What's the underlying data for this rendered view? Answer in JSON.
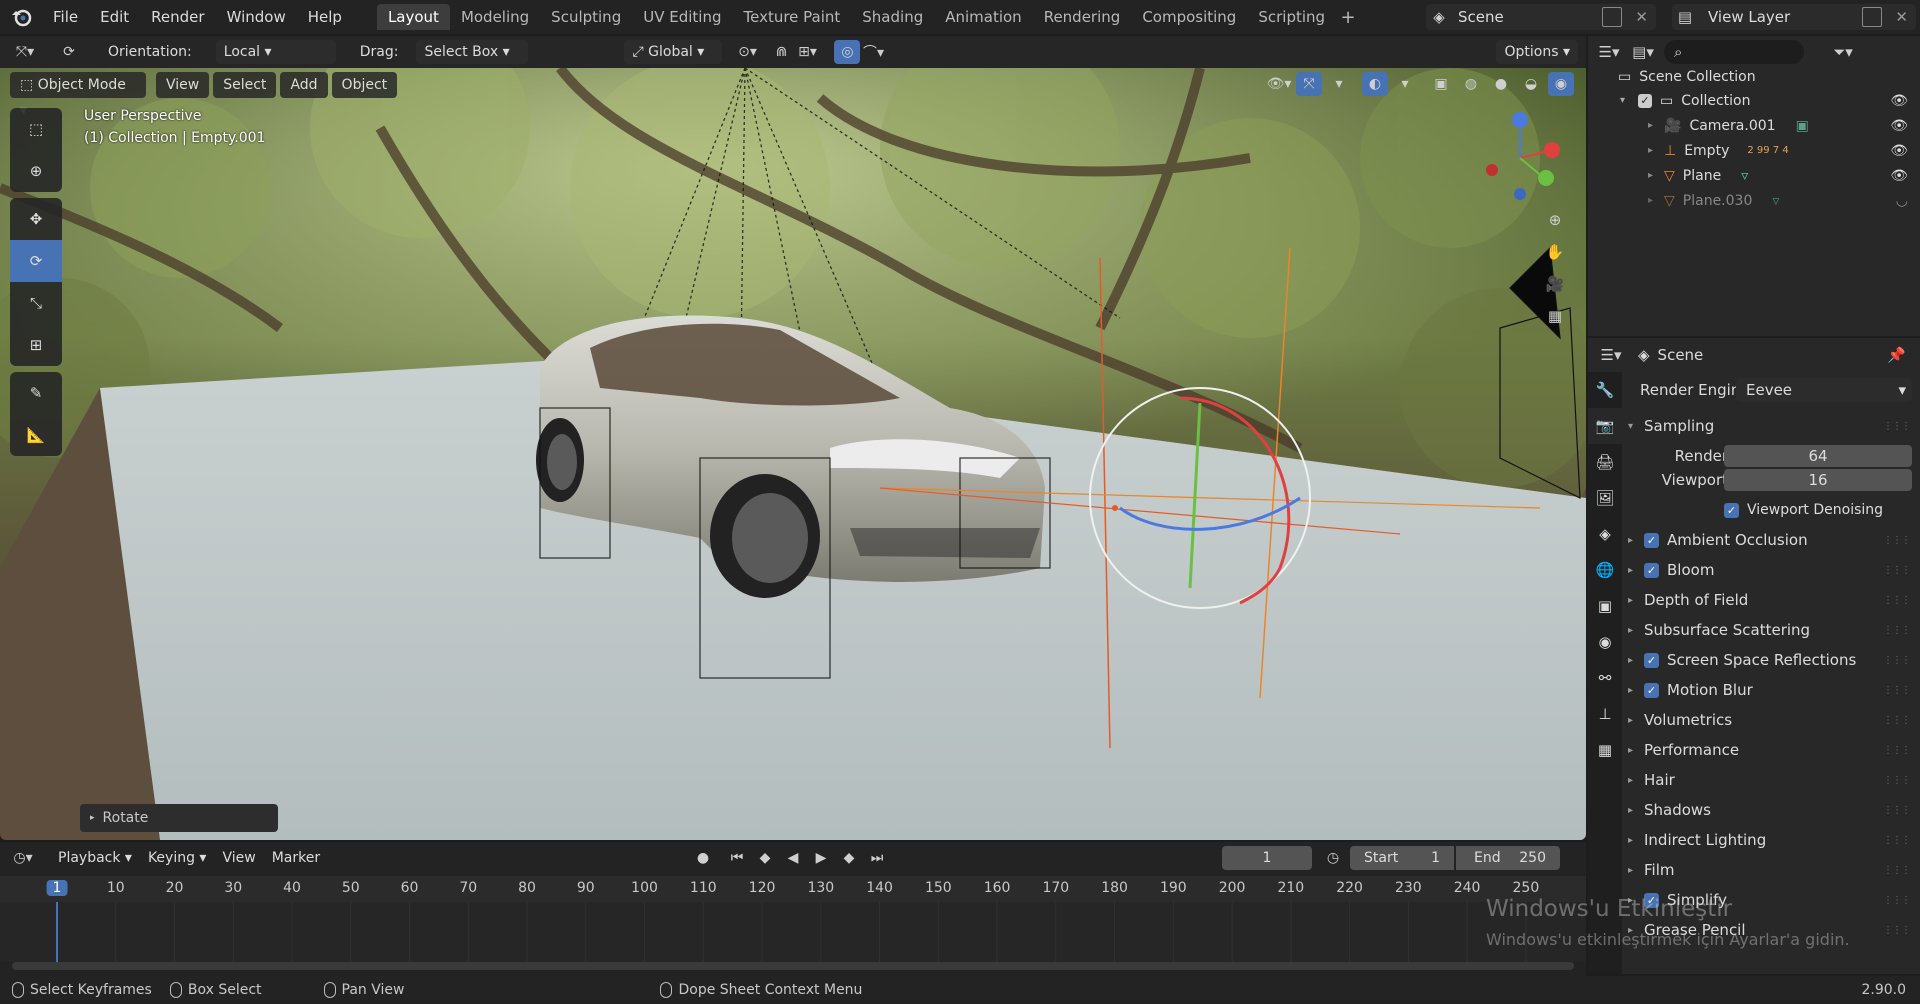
{
  "menu": [
    "File",
    "Edit",
    "Render",
    "Window",
    "Help"
  ],
  "workspaces": [
    "Layout",
    "Modeling",
    "Sculpting",
    "UV Editing",
    "Texture Paint",
    "Shading",
    "Animation",
    "Rendering",
    "Compositing",
    "Scripting"
  ],
  "active_workspace": "Layout",
  "scene_name": "Scene",
  "view_layer": "View Layer",
  "viewport_header": {
    "orientation_label": "Orientation:",
    "orientation_value": "Local",
    "drag_label": "Drag:",
    "drag_value": "Select Box",
    "transform_space": "Global",
    "options": "Options"
  },
  "viewport_bar": {
    "mode": "Object Mode",
    "view": "View",
    "select": "Select",
    "add": "Add",
    "object": "Object"
  },
  "viewport_overlay": {
    "perspective": "User Perspective",
    "collection_info": "(1) Collection | Empty.001",
    "last_op": "Rotate"
  },
  "outliner": {
    "root": "Scene Collection",
    "items": [
      {
        "label": "Collection",
        "badge": ""
      },
      {
        "label": "Camera.001",
        "badge": ""
      },
      {
        "label": "Empty",
        "badge": "2  99  7  4"
      },
      {
        "label": "Plane",
        "badge": ""
      },
      {
        "label": "Plane.030",
        "badge": ""
      }
    ]
  },
  "properties": {
    "context": "Scene",
    "render_engine_label": "Render Engine",
    "render_engine_value": "Eevee",
    "sampling_label": "Sampling",
    "render_label": "Render",
    "render_value": "64",
    "viewport_label": "Viewport",
    "viewport_value": "16",
    "viewport_denoising": "Viewport Denoising",
    "panels": [
      {
        "label": "Ambient Occlusion",
        "checked": true
      },
      {
        "label": "Bloom",
        "checked": true
      },
      {
        "label": "Depth of Field",
        "checked": false
      },
      {
        "label": "Subsurface Scattering",
        "checked": false
      },
      {
        "label": "Screen Space Reflections",
        "checked": true
      },
      {
        "label": "Motion Blur",
        "checked": true
      },
      {
        "label": "Volumetrics",
        "checked": false
      },
      {
        "label": "Performance",
        "checked": false
      },
      {
        "label": "Hair",
        "checked": false
      },
      {
        "label": "Shadows",
        "checked": false
      },
      {
        "label": "Indirect Lighting",
        "checked": false
      },
      {
        "label": "Film",
        "checked": false
      },
      {
        "label": "Simplify",
        "checked": true
      },
      {
        "label": "Grease Pencil",
        "checked": false
      }
    ]
  },
  "timeline": {
    "playback": "Playback",
    "keying": "Keying",
    "view": "View",
    "marker": "Marker",
    "current_frame": "1",
    "start_label": "Start",
    "start_value": "1",
    "end_label": "End",
    "end_value": "250",
    "ticks": [
      "1",
      "10",
      "20",
      "30",
      "40",
      "50",
      "60",
      "70",
      "80",
      "90",
      "100",
      "110",
      "120",
      "130",
      "140",
      "150",
      "160",
      "170",
      "180",
      "190",
      "200",
      "210",
      "220",
      "230",
      "240",
      "250"
    ]
  },
  "statusbar": {
    "select_keyframes": "Select Keyframes",
    "box_select": "Box Select",
    "pan_view": "Pan View",
    "context_menu": "Dope Sheet Context Menu",
    "version": "2.90.0"
  },
  "watermark": {
    "title": "Windows'u Etkinleştir",
    "subtitle": "Windows'u etkinleştirmek için Ayarlar'a gidin."
  },
  "colors": {
    "accent": "#4772b3",
    "bg": "#1d1d1d",
    "panel": "#282828"
  }
}
